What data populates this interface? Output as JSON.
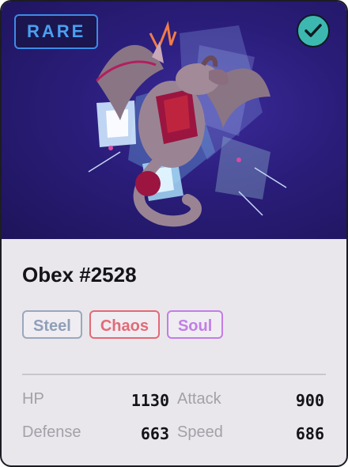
{
  "card": {
    "rarity": "RARE",
    "verified_icon": "checkmark-circle-icon",
    "name": "Obex #2528",
    "tags": [
      {
        "label": "Steel",
        "color": "#8f9fb8"
      },
      {
        "label": "Chaos",
        "color": "#e26a78"
      },
      {
        "label": "Soul",
        "color": "#c27ee6"
      }
    ],
    "stats": [
      {
        "label": "HP",
        "value": "1130"
      },
      {
        "label": "Attack",
        "value": "900"
      },
      {
        "label": "Defense",
        "value": "663"
      },
      {
        "label": "Speed",
        "value": "686"
      }
    ]
  },
  "colors": {
    "art_background": "#2a1d7a",
    "rarity_accent": "#3d8be6",
    "verified_badge": "#3cb8b0"
  }
}
